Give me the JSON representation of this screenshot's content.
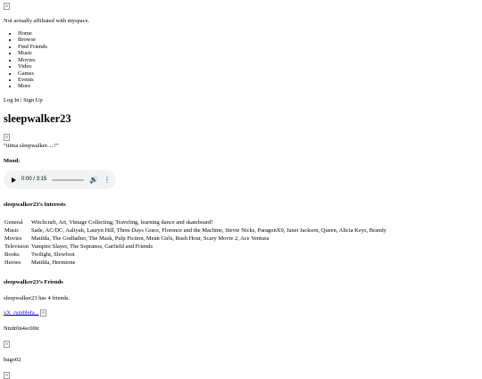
{
  "header": {
    "disclaimer": "Not actually affiliated with myspace."
  },
  "nav": {
    "items": [
      "Home",
      "Browse",
      "Find Friends",
      "Music",
      "Movies",
      "Video",
      "Games",
      "Events",
      "More"
    ]
  },
  "auth": {
    "login": "Log In",
    "separator": "|",
    "signup": "Sign Up"
  },
  "profile": {
    "username": "sleepwalker23",
    "quote": "“iiima sleepwalker.....!”",
    "mood_label": "Mood:"
  },
  "audio_player": {
    "time": "0:00 / 3:15",
    "progress": 0
  },
  "interests": {
    "heading": "sleepwalker23’s Interests",
    "rows": [
      {
        "category": "General",
        "value": "Witchcraft, Art, Vintage Collecting, Traveling, learning dance and skateboard!"
      },
      {
        "category": "Music",
        "value": "Sade, AC/DC, Aaliyah, Lauryn Hill, Three Days Grace, Florence and the Machine, Stevie Nicks, ParagonX9, Janet Jackson, Queen, Alicia Keys, Brandy"
      },
      {
        "category": "Movies",
        "value": "Matilda, The Godfather, The Mask, Pulp Fiction, Mean Girls, Rush Hour, Scary Movie 2, Ace Ventura"
      },
      {
        "category": "Television",
        "value": "Vampire Slayer, The Sopranos, Garfield and Friends"
      },
      {
        "category": "Books",
        "value": "Twilight, Slewfoot"
      },
      {
        "category": "Heroes",
        "value": "Matilda, Hermione"
      }
    ]
  },
  "friends": {
    "heading": "sleepwalker23’s Friends",
    "count_text": "sleepwalker23 has 4 friends.",
    "list": [
      {
        "name": "xX_rumblefa...",
        "linked": true
      },
      {
        "name": "Ntrdr0n4sc00tr",
        "linked": false
      },
      {
        "name": "hugo02",
        "linked": false
      }
    ]
  }
}
